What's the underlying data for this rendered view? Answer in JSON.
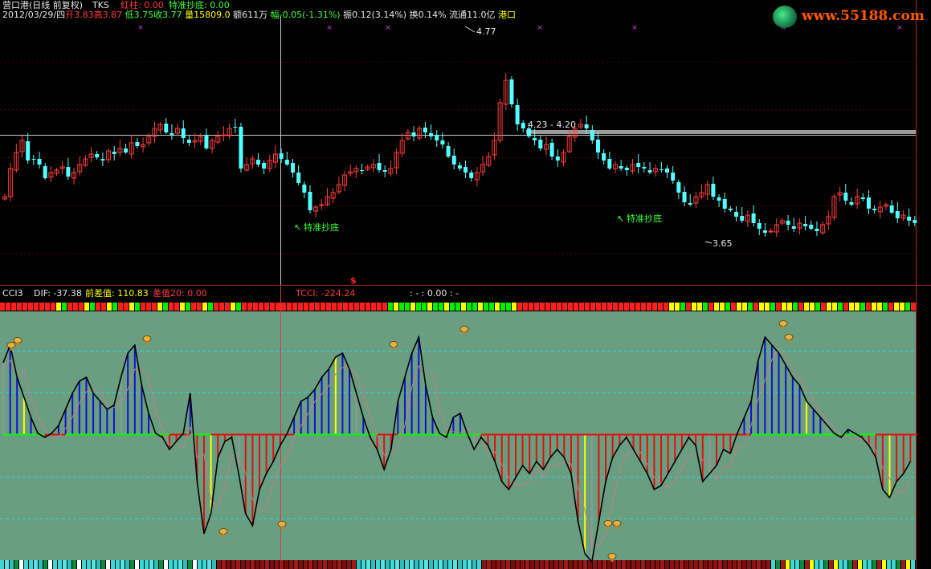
{
  "colors": {
    "up": "#ff3c3c",
    "down": "#54ffff",
    "osc_bg": "#6a9e80",
    "osc_blue": "#1010d8",
    "osc_red": "#e01010",
    "osc_gray": "#8a9a9a",
    "signal": "#ffff00",
    "green_strip": "#00ff00",
    "label_green": "#3cff3c",
    "label_red": "#ff3c3c",
    "label_yellow": "#ffff00",
    "label_white": "#ffffff"
  },
  "header": {
    "line1": {
      "security": "营口港(日线 前复权)",
      "code": "TKS",
      "red_col_label": "红柱: 0.00",
      "special_bottom_label": "特准抄底: 0.00"
    },
    "line2": {
      "date": "2012/03/29/四",
      "open_label": "开",
      "open": "3.83",
      "high_label": "高",
      "high": "3.87",
      "low_label": "低",
      "low": "3.75",
      "close_label": "收",
      "close": "3.77",
      "volume_label": "量",
      "volume": "15809.0",
      "amount_label": "额",
      "amount": "611万",
      "change_label": "幅",
      "change": "-0.05(-1.31%)",
      "amplitude_label": "振",
      "amplitude": "0.12(3.14%)",
      "turnover_label": "换",
      "turnover": "0.14%",
      "float_label": "流通",
      "float": "11.0亿",
      "sector": "港口"
    }
  },
  "watermark": "www.55188.com",
  "main_chart": {
    "peak_label": "4.77",
    "range_label": "4.23 - 4.20",
    "trough_label": "3.65",
    "signal_label_1": "特准抄底",
    "signal_label_2": "特准抄底",
    "dollar_marker": "$",
    "x_marker": "×"
  },
  "indicator_header": {
    "name": "CCI3",
    "dif": "DIF: -37.38",
    "prev_diff": "前差值: 110.83",
    "diff20": "差值20: 0.00",
    "tcci": "TCCI: -224.24",
    "misc": ": - : 0.00 : -"
  },
  "chart_data": [
    {
      "type": "candlestick",
      "title": "营口港(日线 前复权)",
      "annotated_values": {
        "high": 4.77,
        "low": 3.65,
        "range_high": 4.23,
        "range_low": 4.2
      },
      "signals": [
        "特准抄底",
        "特准抄底"
      ]
    },
    {
      "type": "oscillator",
      "name": "CCI3",
      "readout": {
        "DIF": -37.38,
        "前差值": 110.83,
        "差值20": 0.0,
        "TCCI": -224.24
      }
    }
  ]
}
